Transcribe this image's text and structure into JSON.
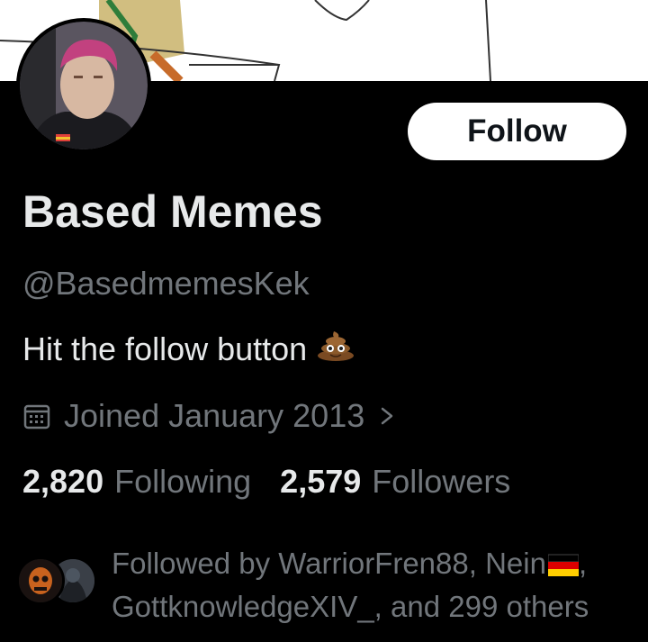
{
  "profile": {
    "follow_label": "Follow",
    "display_name": "Based Memes",
    "handle": "@BasedmemesKek",
    "bio": "Hit the follow button",
    "bio_emoji": "poop-emoji",
    "joined": "Joined January 2013",
    "joined_chevron": "›",
    "following_count": "2,820",
    "following_label": "Following",
    "followers_count": "2,579",
    "followers_label": "Followers",
    "followed_by_line1": "Followed by WarriorFren88, Nein",
    "followed_by_line1_end": ",",
    "followed_by_line2": "GottknowledgeXIV_, and 299 others"
  },
  "colors": {
    "background": "#000000",
    "primary_text": "#e7e9ea",
    "secondary_text": "#71767b",
    "follow_button_bg": "#ffffff",
    "follow_button_text": "#0f1419"
  },
  "icons": {
    "calendar": "calendar-icon",
    "chevron": "chevron-right-icon",
    "flag": "german-flag-icon"
  }
}
